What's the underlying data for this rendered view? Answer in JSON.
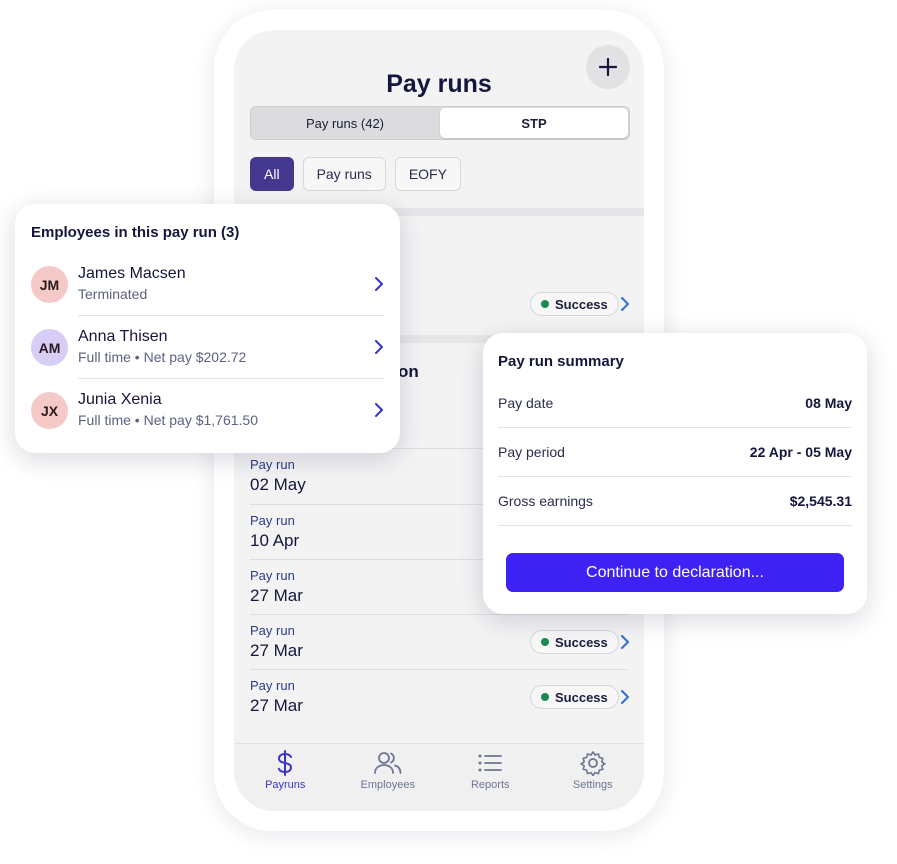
{
  "header": {
    "title": "Pay runs"
  },
  "segmented": {
    "tab1": "Pay runs (42)",
    "tab2": "STP",
    "selected": "STP"
  },
  "filters": {
    "items": [
      "All",
      "Pay runs",
      "EOFY"
    ],
    "selected": "All"
  },
  "list": {
    "partial_heading": "on",
    "rows": [
      {
        "label": "Pay run",
        "date": "02 May",
        "status": ""
      },
      {
        "label": "Pay run",
        "date": "10 Apr",
        "status": ""
      },
      {
        "label": "Pay run",
        "date": "27 Mar",
        "status": ""
      },
      {
        "label": "Pay run",
        "date": "27 Mar",
        "status": "Success"
      },
      {
        "label": "Pay run",
        "date": "27 Mar",
        "status": "Success"
      }
    ],
    "first_status": "Success"
  },
  "tabbar": {
    "items": [
      {
        "label": "Payruns",
        "icon": "dollar-icon"
      },
      {
        "label": "Employees",
        "icon": "people-icon"
      },
      {
        "label": "Reports",
        "icon": "list-icon"
      },
      {
        "label": "Settings",
        "icon": "gear-icon"
      }
    ],
    "selected": "Payruns"
  },
  "employees_card": {
    "title": "Employees in this pay run (3)",
    "employees": [
      {
        "initials": "JM",
        "name": "James Macsen",
        "detail": "Terminated",
        "avatar_color": "#f6c9c9"
      },
      {
        "initials": "AM",
        "name": "Anna Thisen",
        "detail": "Full time • Net pay $202.72",
        "avatar_color": "#d7cdf7"
      },
      {
        "initials": "JX",
        "name": "Junia Xenia",
        "detail": "Full time • Net pay $1,761.50",
        "avatar_color": "#f6c9c9"
      }
    ]
  },
  "summary_card": {
    "title": "Pay run summary",
    "rows": [
      {
        "label": "Pay date",
        "value": "08 May"
      },
      {
        "label": "Pay period",
        "value": "22 Apr - 05 May"
      },
      {
        "label": "Gross earnings",
        "value": "$2,545.31"
      }
    ],
    "cta": "Continue to declaration..."
  },
  "colors": {
    "accent": "#3e22f3",
    "chip_active": "#43378f",
    "success": "#1c8a4e",
    "link": "#2c6fd6"
  }
}
